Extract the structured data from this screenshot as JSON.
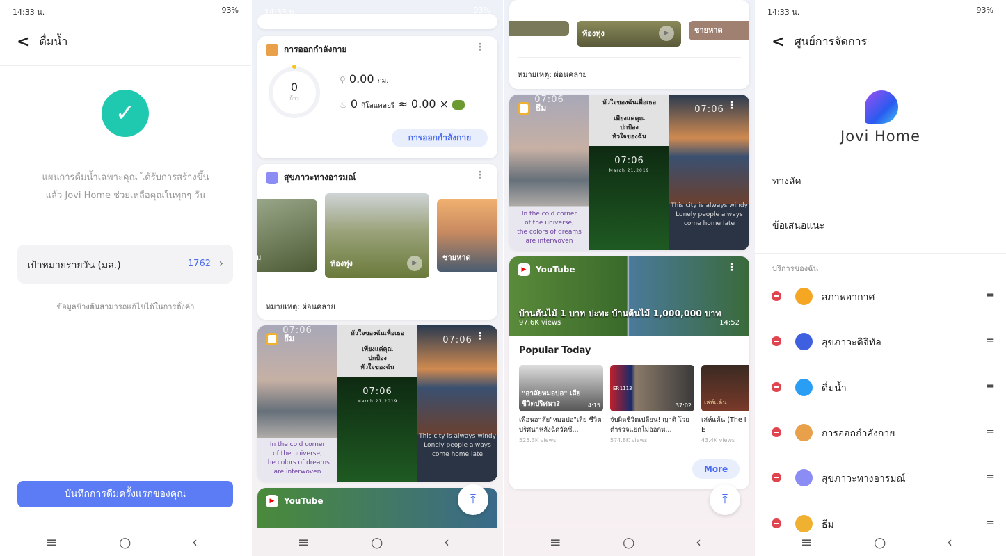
{
  "status": {
    "time": "14:33 น.",
    "battery": "93%"
  },
  "water": {
    "title": "ดื่มน้ำ",
    "message_line1": "แผนการดื่มน้ำเฉพาะคุณ ได้รับการสร้างขึ้น",
    "message_line2": "แล้ว Jovi Home ช่วยเหลือคุณในทุกๆ วัน",
    "goal_label": "เป้าหมายรายวัน (มล.)",
    "goal_value": "1762",
    "hint": "ข้อมูลข้างต้นสามารถแก้ไขได้ในการตั้งค่า",
    "record_button": "บันทึกการดื่มครั้งแรกของคุณ"
  },
  "exercise": {
    "title": "การออกกำลังกาย",
    "steps": "0",
    "steps_unit": "ก้าว",
    "distance": "0.00",
    "distance_unit": "กม.",
    "calories": "0",
    "calories_unit": "กิโลแคลอรี",
    "equiv": "≈ 0.00 ×",
    "button": "การออกกำลังกาย"
  },
  "mood": {
    "title": "สุขภาวะทางอารมณ์",
    "thumbs": [
      "ม",
      "ท้องทุ่ง",
      "ชายหาด"
    ],
    "note": "หมายเหตุ: ผ่อนคลาย"
  },
  "theme": {
    "title": "ธีม",
    "clock": "07:06",
    "date": "March 21,2019",
    "poem_left": [
      "In the cold corner",
      "of the universe,",
      "the colors of dreams",
      "are interwoven"
    ],
    "poem_mid": [
      "หัวใจของฉันเพื่อเธอ",
      "เพียงแค่คุณ",
      "ปกป้อง",
      "หัวใจของฉัน"
    ],
    "poem_right": [
      "This city is always windy",
      "Lonely people always",
      "come home late"
    ]
  },
  "youtube": {
    "title": "YouTube",
    "featured_title": "บ้านต้นไม้ 1 บาท ปะทะ บ้านต้นไม้ 1,000,000 บาท",
    "featured_views": "97.6K views",
    "featured_duration": "14:52",
    "popular_heading": "Popular Today",
    "videos": [
      {
        "overlay": "\"อาลัยหมอปอ\" เสียชีวิตปริศนา?",
        "duration": "4:15",
        "title": "เพื่อนอาลัย\"หมอปอ\"เสีย ชีวิตปริศนาหลังฉีดวัคซี...",
        "views": "525.3K views"
      },
      {
        "overlay": "EP.1113",
        "duration": "37:02",
        "title": "จับผิดชีวิตเปลี่ยน! ญาติ โวย ตำรวจแยกไม่ออกห...",
        "views": "574.8K views"
      },
      {
        "overlay": "เล่ห์แค้น",
        "duration": "",
        "title": "เล่ห์แค้น (The I ตัวอย่างซีรีส์ E",
        "views": "43.4K views"
      }
    ],
    "more": "More"
  },
  "manage": {
    "title": "ศูนย์การจัดการ",
    "logo_text": "Jovi Home",
    "shortcut": "ทางลัด",
    "feedback": "ข้อเสนอแนะ",
    "section": "บริการของฉัน",
    "services": [
      {
        "label": "สภาพอากาศ",
        "icon": "weather-icon",
        "color": "#f5a623"
      },
      {
        "label": "สุขภาวะดิจิทัล",
        "icon": "digital-wellbeing-icon",
        "color": "#3d5fe0"
      },
      {
        "label": "ดื่มน้ำ",
        "icon": "water-glass-icon",
        "color": "#2a9df4"
      },
      {
        "label": "การออกกำลังกาย",
        "icon": "exercise-shoe-icon",
        "color": "#e8a04a"
      },
      {
        "label": "สุขภาวะทางอารมณ์",
        "icon": "sound-wave-icon",
        "color": "#8c8cf5"
      },
      {
        "label": "ธีม",
        "icon": "theme-ring-icon",
        "color": "#f0b030"
      }
    ]
  },
  "colors": {
    "accent": "#5b7cf5",
    "teal": "#1fc9b0",
    "remove": "#e0454f"
  }
}
